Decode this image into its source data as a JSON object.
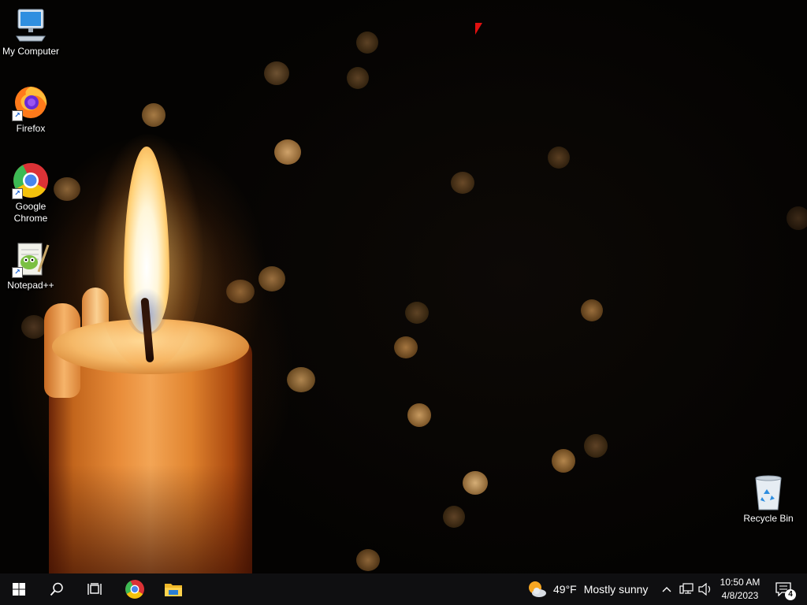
{
  "desktop": {
    "wallpaper": "candle-bokeh",
    "icons": [
      {
        "label": "My Computer",
        "icon": "computer-icon"
      },
      {
        "label": "Firefox",
        "icon": "firefox-icon"
      },
      {
        "label": "Google Chrome",
        "icon": "chrome-icon"
      },
      {
        "label": "Notepad++",
        "icon": "notepadpp-icon"
      },
      {
        "label": "Recycle Bin",
        "icon": "recycle-bin-icon"
      }
    ]
  },
  "taskbar": {
    "start": "windows-start-icon",
    "search": "search-icon",
    "task_view": "task-view-icon",
    "pinned": [
      "chrome-icon",
      "file-explorer-icon"
    ],
    "weather": {
      "temp": "49°F",
      "condition": "Mostly sunny",
      "icon": "partly-sunny-icon"
    },
    "tray": [
      "chevron-up-icon",
      "network-icon",
      "volume-icon"
    ],
    "clock": {
      "time": "10:50 AM",
      "date": "4/8/2023"
    },
    "notifications": {
      "count": "4",
      "icon": "action-center-icon"
    }
  },
  "colors": {
    "taskbar": "#0f0f11",
    "accent": "#7aa7e8",
    "cursor": "#e01010"
  }
}
